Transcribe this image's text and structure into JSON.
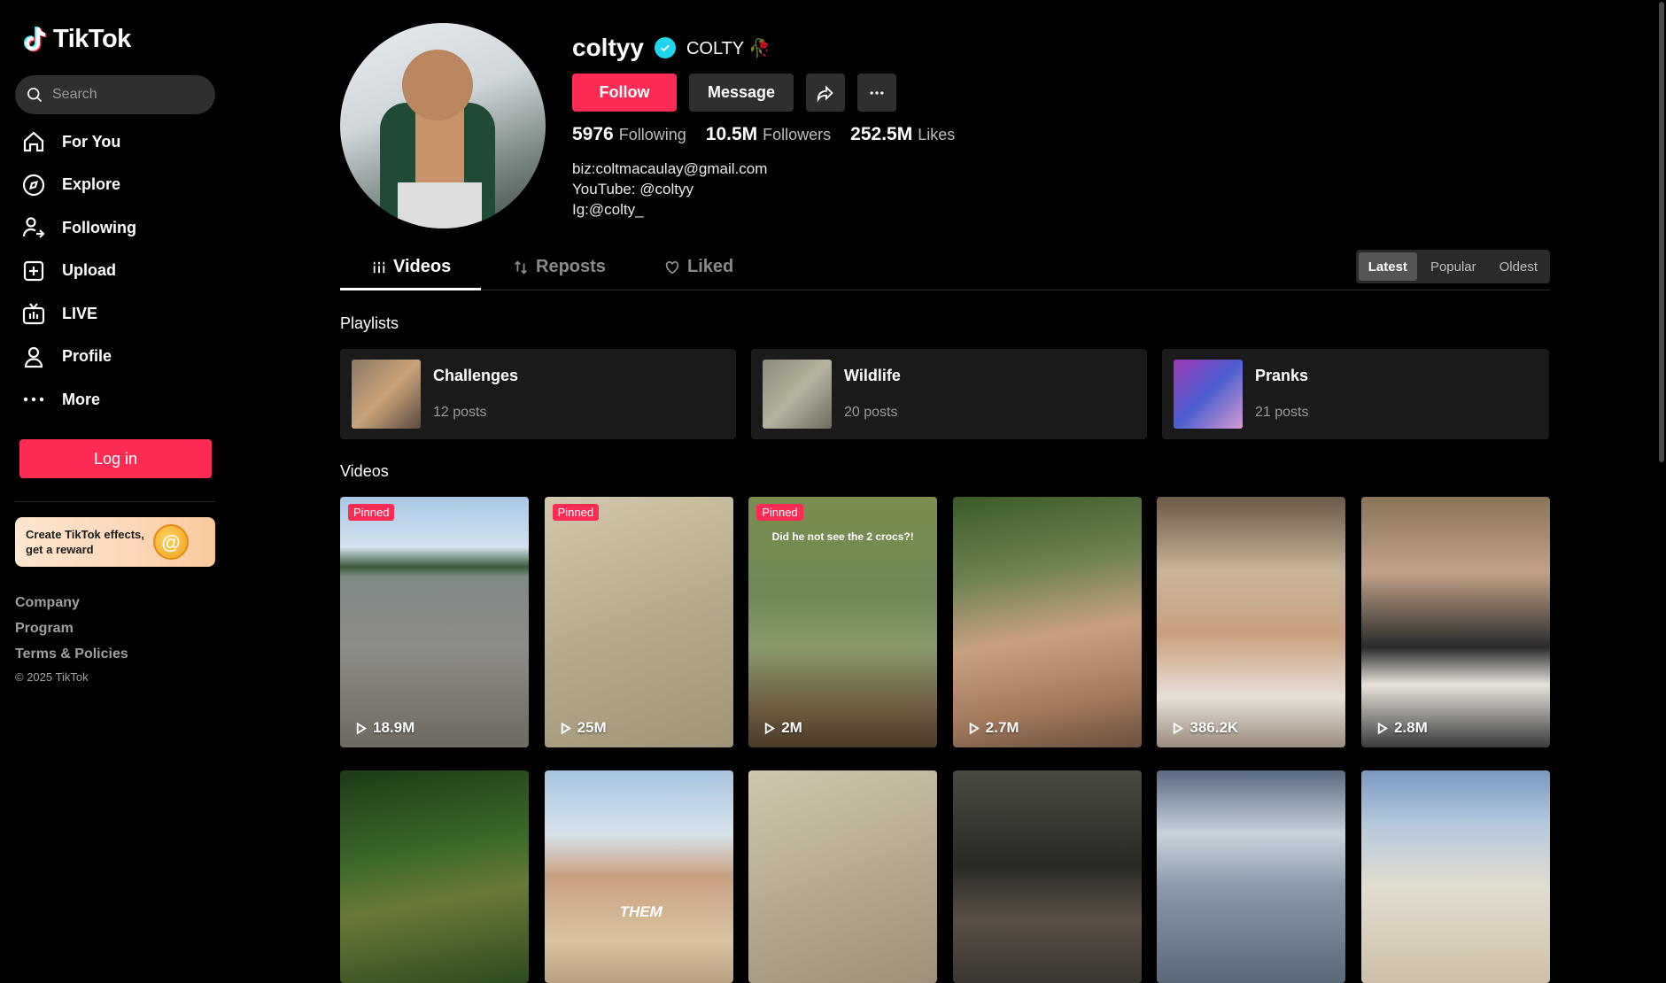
{
  "app": {
    "brand": "TikTok"
  },
  "search": {
    "placeholder": "Search"
  },
  "nav": [
    {
      "label": "For You",
      "icon": "home-icon"
    },
    {
      "label": "Explore",
      "icon": "compass-icon"
    },
    {
      "label": "Following",
      "icon": "following-icon"
    },
    {
      "label": "Upload",
      "icon": "upload-icon"
    },
    {
      "label": "LIVE",
      "icon": "live-icon"
    },
    {
      "label": "Profile",
      "icon": "profile-icon"
    },
    {
      "label": "More",
      "icon": "more-icon"
    }
  ],
  "login": {
    "label": "Log in"
  },
  "promo": {
    "text": "Create TikTok effects, get a reward"
  },
  "footer": {
    "company": "Company",
    "program": "Program",
    "terms": "Terms & Policies",
    "copyright": "© 2025 TikTok"
  },
  "profile": {
    "username": "coltyy",
    "nickname": "COLTY 🥀",
    "follow_label": "Follow",
    "message_label": "Message",
    "stats": {
      "following": "5976",
      "following_label": "Following",
      "followers": "10.5M",
      "followers_label": "Followers",
      "likes": "252.5M",
      "likes_label": "Likes"
    },
    "bio": [
      "biz:coltmacaulay@gmail.com",
      "YouTube: @coltyy",
      "Ig:@colty_"
    ]
  },
  "tabs": {
    "videos": "Videos",
    "reposts": "Reposts",
    "liked": "Liked"
  },
  "sort": {
    "latest": "Latest",
    "popular": "Popular",
    "oldest": "Oldest",
    "selected": "Latest"
  },
  "playlists_title": "Playlists",
  "playlists": [
    {
      "name": "Challenges",
      "count": "12 posts"
    },
    {
      "name": "Wildlife",
      "count": "20 posts"
    },
    {
      "name": "Pranks",
      "count": "21 posts"
    }
  ],
  "videos_title": "Videos",
  "pinned_label": "Pinned",
  "videos": [
    {
      "views": "18.9M",
      "pinned": true
    },
    {
      "views": "25M",
      "pinned": true
    },
    {
      "views": "2M",
      "pinned": true,
      "caption": "Did he not see the 2 crocs?!"
    },
    {
      "views": "2.7M"
    },
    {
      "views": "386.2K"
    },
    {
      "views": "2.8M"
    },
    {
      "views": ""
    },
    {
      "views": "",
      "overlay": "THEM"
    },
    {
      "views": ""
    },
    {
      "views": ""
    },
    {
      "views": ""
    },
    {
      "views": ""
    }
  ],
  "colors": {
    "accent": "#fe2c55",
    "verified": "#20d5ec",
    "background": "#000000"
  }
}
